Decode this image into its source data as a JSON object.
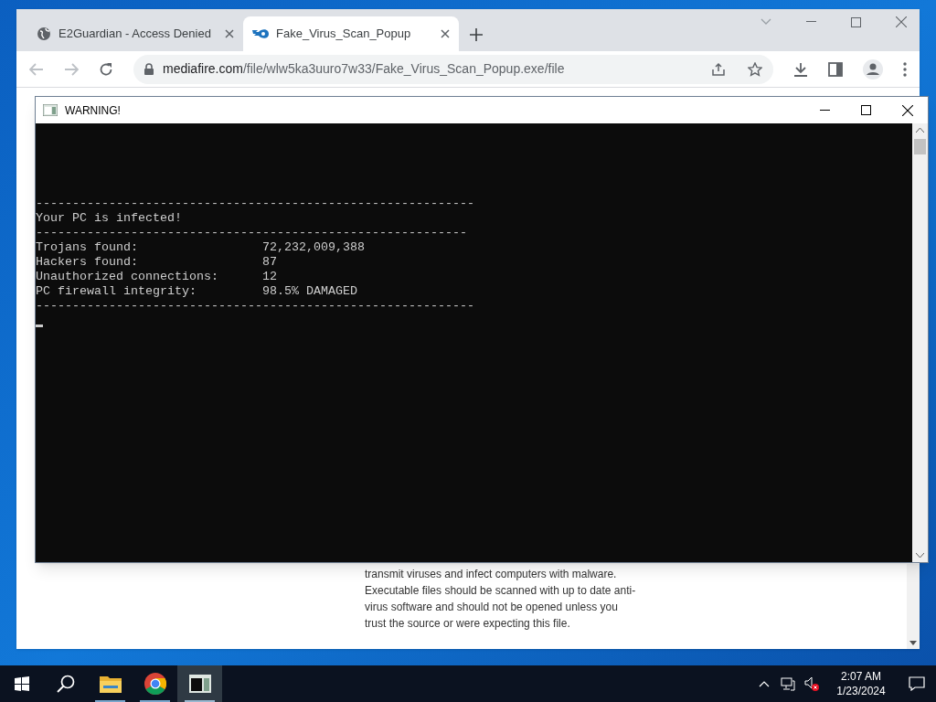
{
  "browser": {
    "tabs": [
      {
        "title": "E2Guardian - Access Denied",
        "selected": false
      },
      {
        "title": "Fake_Virus_Scan_Popup",
        "selected": true
      }
    ],
    "url": {
      "host": "mediafire.com",
      "path": "/file/wlw5ka3uuro7w33/Fake_Virus_Scan_Popup.exe/file"
    },
    "page_text_lines": [
      "transmit viruses and infect computers with malware.",
      "Executable files should be scanned with up to date anti-",
      "virus software and should not be opened unless you",
      "trust the source or were expecting this file."
    ]
  },
  "console": {
    "title": "WARNING!",
    "lines": [
      "------------------------------------------------------------",
      "Your PC is infected!",
      "-----------------------------------------------------------",
      "Trojans found:                 72,232,009,388",
      "Hackers found:                 87",
      "Unauthorized connections:      12",
      "PC firewall integrity:         98.5% DAMAGED",
      "------------------------------------------------------------"
    ]
  },
  "taskbar": {
    "apps": [
      {
        "kind": "explorer",
        "active": false
      },
      {
        "kind": "chrome",
        "active": false
      },
      {
        "kind": "console",
        "active": true
      }
    ],
    "time": "2:07 AM",
    "date": "1/23/2024"
  }
}
